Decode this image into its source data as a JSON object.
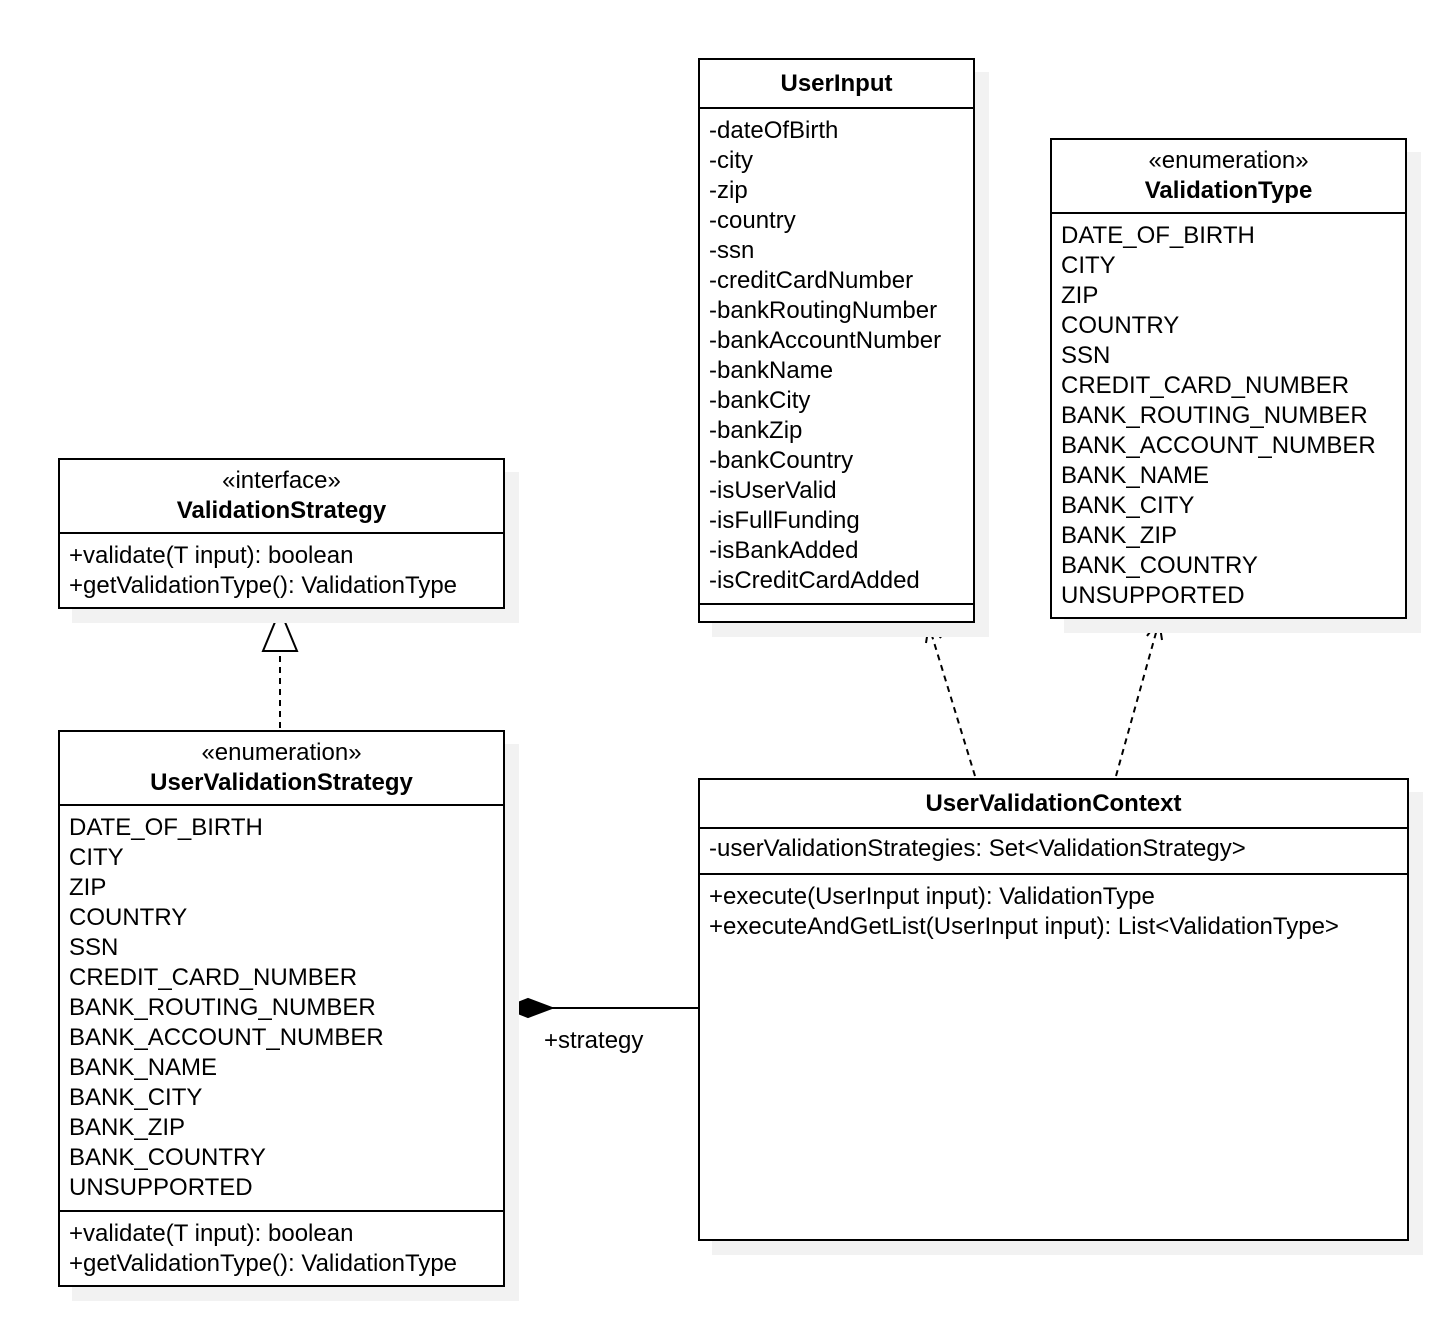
{
  "classes": {
    "userInput": {
      "stereotype": "",
      "name": "UserInput",
      "attributes": [
        "-dateOfBirth",
        "-city",
        "-zip",
        "-country",
        "-ssn",
        "-creditCardNumber",
        "-bankRoutingNumber",
        "-bankAccountNumber",
        "-bankName",
        "-bankCity",
        "-bankZip",
        "-bankCountry",
        "-isUserValid",
        "-isFullFunding",
        "-isBankAdded",
        "-isCreditCardAdded"
      ],
      "methods": []
    },
    "validationType": {
      "stereotype": "«enumeration»",
      "name": "ValidationType",
      "attributes": [
        "DATE_OF_BIRTH",
        "CITY",
        "ZIP",
        "COUNTRY",
        "SSN",
        "CREDIT_CARD_NUMBER",
        "BANK_ROUTING_NUMBER",
        "BANK_ACCOUNT_NUMBER",
        "BANK_NAME",
        "BANK_CITY",
        "BANK_ZIP",
        "BANK_COUNTRY",
        "UNSUPPORTED"
      ]
    },
    "validationStrategy": {
      "stereotype": "«interface»",
      "name": "ValidationStrategy",
      "methods": [
        "+validate(T input): boolean",
        "+getValidationType(): ValidationType"
      ]
    },
    "userValidationStrategy": {
      "stereotype": "«enumeration»",
      "name": "UserValidationStrategy",
      "attributes": [
        "DATE_OF_BIRTH",
        "CITY",
        "ZIP",
        "COUNTRY",
        "SSN",
        "CREDIT_CARD_NUMBER",
        "BANK_ROUTING_NUMBER",
        "BANK_ACCOUNT_NUMBER",
        "BANK_NAME",
        "BANK_CITY",
        "BANK_ZIP",
        "BANK_COUNTRY",
        "UNSUPPORTED"
      ],
      "methods": [
        "+validate(T input): boolean",
        "+getValidationType(): ValidationType"
      ]
    },
    "userValidationContext": {
      "stereotype": "",
      "name": "UserValidationContext",
      "attributes": [
        "-userValidationStrategies: Set<ValidationStrategy>"
      ],
      "methods": [
        "+execute(UserInput input): ValidationType",
        "+executeAndGetList(UserInput input): List<ValidationType>"
      ]
    }
  },
  "relations": [
    {
      "type": "realization",
      "from": "UserValidationStrategy",
      "to": "ValidationStrategy"
    },
    {
      "type": "dependency",
      "from": "UserValidationContext",
      "to": "UserInput"
    },
    {
      "type": "dependency",
      "from": "UserValidationContext",
      "to": "ValidationType"
    },
    {
      "type": "composition",
      "from": "UserValidationContext",
      "to": "UserValidationStrategy",
      "label": "+strategy"
    }
  ]
}
